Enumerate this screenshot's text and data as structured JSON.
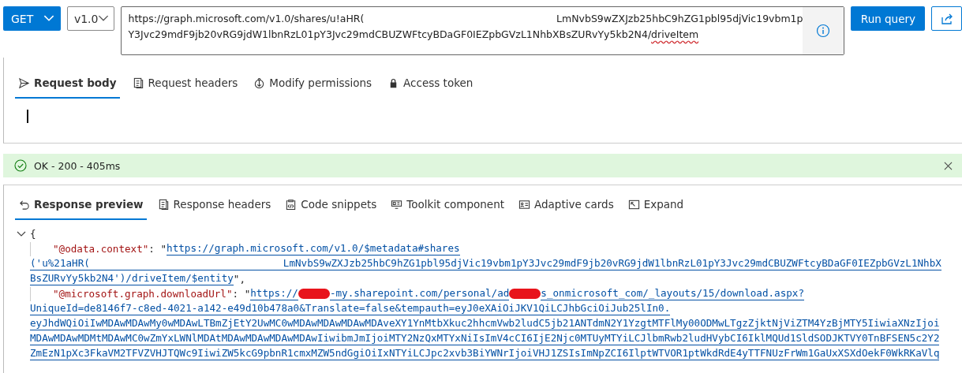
{
  "query": {
    "method": "GET",
    "version": "v1.0",
    "url_lines": [
      [
        {
          "kind": "text",
          "text": "https://graph.microsoft.com/v1.0/shares/u!aHR("
        },
        {
          "kind": "gap"
        },
        {
          "kind": "text",
          "text": "LmNvbS9wZXJzb25hbC9hZG1pbl95djVic19vbm1p"
        }
      ],
      [
        {
          "kind": "text",
          "text": "Y3Jvc29mdF9jb20vRG9jdW1lbnRzL01pY3Jvc29mdCBUZWFtcyBDaGF0IEZpbGVzL1NhbXBsZURvYy5kb2N4/"
        },
        {
          "kind": "misspelled",
          "text": "driveItem"
        }
      ]
    ],
    "run_label": "Run query"
  },
  "request_tabs": [
    {
      "label": "Request body",
      "selected": true
    },
    {
      "label": "Request headers",
      "selected": false
    },
    {
      "label": "Modify permissions",
      "selected": false
    },
    {
      "label": "Access token",
      "selected": false
    }
  ],
  "status": {
    "text": "OK - 200 - 405ms",
    "kind": "success"
  },
  "response_tabs": [
    {
      "label": "Response preview",
      "selected": true
    },
    {
      "label": "Response headers",
      "selected": false
    },
    {
      "label": "Code snippets",
      "selected": false
    },
    {
      "label": "Toolkit component",
      "selected": false
    },
    {
      "label": "Adaptive cards",
      "selected": false
    },
    {
      "label": "Expand",
      "selected": false
    }
  ],
  "response_lines": [
    {
      "kind": "open",
      "segments": [
        {
          "kind": "punct",
          "text": "{"
        }
      ]
    },
    {
      "kind": "member",
      "segments": [
        {
          "kind": "key",
          "text": "\"@odata.context\""
        },
        {
          "kind": "punct",
          "text": ": \""
        },
        {
          "kind": "link",
          "text": "https://graph.microsoft.com/v1.0/$metadata#shares"
        }
      ]
    },
    {
      "kind": "cont",
      "segments": [
        {
          "kind": "link",
          "text": "('u%21aHR("
        },
        {
          "kind": "gap"
        },
        {
          "kind": "link",
          "text": "LmNvbS9wZXJzb25hbC9hZG1pbl95djVic19vbm1pY3Jvc29mdF9jb20vRG9jdW1lbnRzL01pY3Jvc29mdCBUZWFtcyBDaGF0IEZpbGVzL1NhbX"
        }
      ]
    },
    {
      "kind": "cont",
      "segments": [
        {
          "kind": "link",
          "text": "BsZURvYy5kb2N4')/driveItem/$entity"
        },
        {
          "kind": "punct",
          "text": "\","
        }
      ]
    },
    {
      "kind": "member",
      "segments": [
        {
          "kind": "key",
          "text": "\"@microsoft.graph.downloadUrl\""
        },
        {
          "kind": "punct",
          "text": ": \""
        },
        {
          "kind": "link",
          "text": "https://"
        },
        {
          "kind": "redaction"
        },
        {
          "kind": "link",
          "text": "-my.sharepoint.com/personal/ad"
        },
        {
          "kind": "redaction"
        },
        {
          "kind": "link",
          "text": "s_onmicrosoft_com/_layouts/15/download.aspx?"
        }
      ]
    },
    {
      "kind": "cont",
      "segments": [
        {
          "kind": "link",
          "text": "UniqueId=de8146f7-c8ed-4021-a142-e49d10b478a0&Translate=false&tempauth=eyJ0eXAiOiJKV1QiLCJhbGciOiJub25lIn0."
        }
      ]
    },
    {
      "kind": "cont",
      "segments": [
        {
          "kind": "link",
          "text": "eyJhdWQiOiIwMDAwMDAwMy0wMDAwLTBmZjEtY2UwMC0wMDAwMDAwMDAwMDAveXY1YnMtbXkuc2hhcmVwb2ludC5jb21ANTdmN2Y1YzgtMTFlMy00ODMwLTgzZjktNjViZTM4YzBjMTY5IiwiaXNzIjoi"
        }
      ]
    },
    {
      "kind": "cont",
      "segments": [
        {
          "kind": "link",
          "text": "MDAwMDAwMDMtMDAwMC0wZmYxLWNlMDAtMDAwMDAwMDAwMDAwIiwibmJmIjoiMTY2NzQxMTYxNiIsImV4cCI6IjE2Njc0MTUyMTYiLCJlbmRwb2ludHVybCI6IklMQUd1SldSODJKTVY0TnBFSEN5c2Y2"
        }
      ]
    },
    {
      "kind": "cont",
      "segments": [
        {
          "kind": "link",
          "text": "ZmEzN1pXc3FkaVM2TFVZVHJTQWc9IiwiZW5kcG9pbnR1cmxMZW5ndGgiOiIxNTYiLCJpc2xvb3BiYWNrIjoiVHJ1ZSIsImNpZCI6IlptWTVOR1ptWkdRdE4yTTFNUzFrWm1GaUxXSXdOekF0WkRKaVlq"
        }
      ]
    }
  ]
}
